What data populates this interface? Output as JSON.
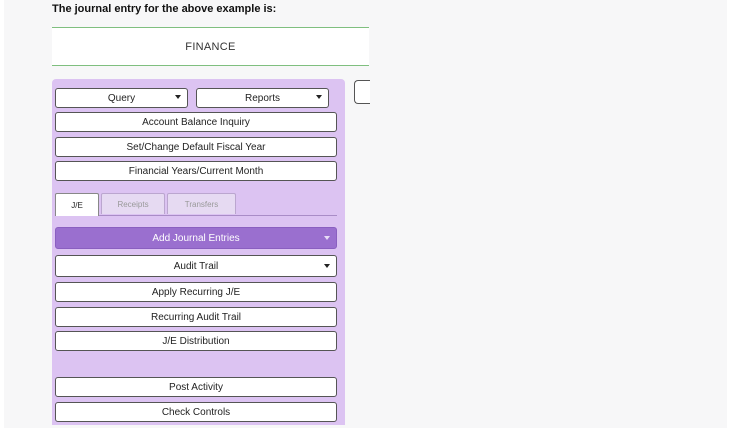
{
  "intro_text": "The journal entry for the above example is:",
  "finance_title": "FINANCE",
  "menu": {
    "query_label": "Query",
    "reports_label": "Reports",
    "account_balance_inquiry": "Account Balance Inquiry",
    "set_change_default_fiscal_year": "Set/Change Default Fiscal Year",
    "financial_years_current_month": "Financial Years/Current Month"
  },
  "tabs": [
    {
      "label": "J/E",
      "selected": true
    },
    {
      "label": "Receipts",
      "selected": false
    },
    {
      "label": "Transfers",
      "selected": false
    }
  ],
  "je_menu": {
    "add_journal_entries": "Add Journal Entries",
    "audit_trail": "Audit Trail",
    "apply_recurring_je": "Apply Recurring J/E",
    "recurring_audit_trail": "Recurring Audit Trail",
    "je_distribution": "J/E Distribution",
    "post_activity": "Post Activity",
    "check_controls": "Check Controls"
  },
  "colors": {
    "panel_bg": "#dcc3f2",
    "active_button": "#9a6fcf",
    "finance_border": "#7fbf7f"
  }
}
